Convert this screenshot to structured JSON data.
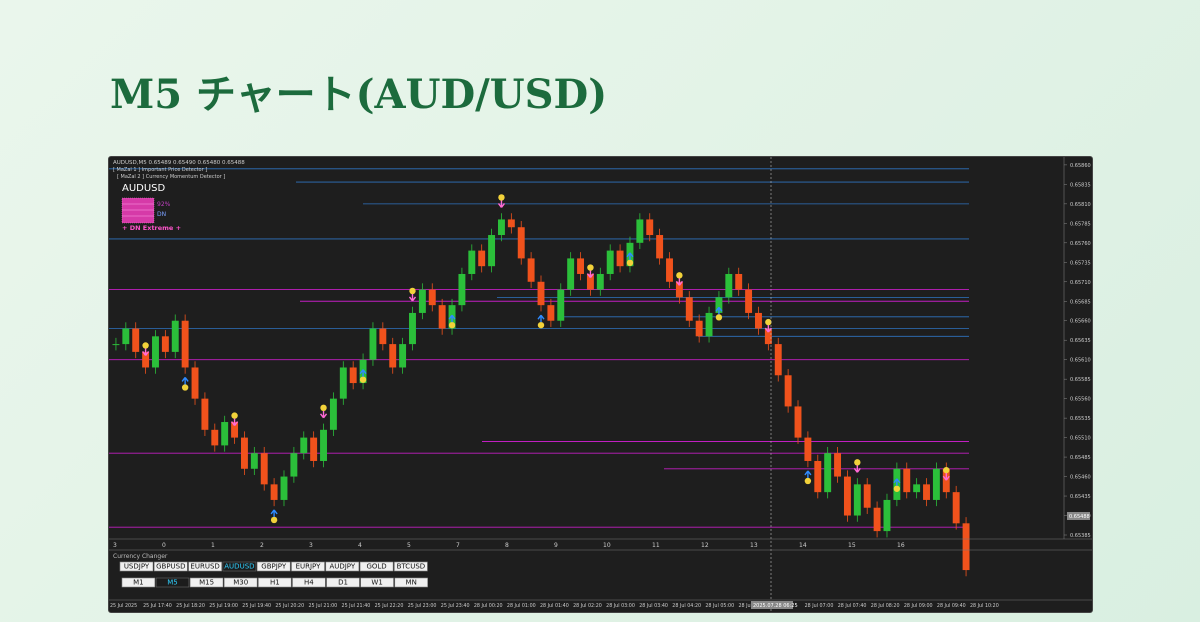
{
  "page_title": "M5 チャート(AUD/USD)",
  "header": {
    "symbol_info": "AUDUSD,M5  0.65489 0.65490 0.65480 0.65488",
    "indicator1": "[ MaZal 1 ] Important Price Detector ]",
    "indicator2": "[ MaZal 2 ] Currency Momentum Detector ]",
    "pair": "AUDUSD",
    "strength_pct": "92%",
    "strength_dn": "DN",
    "extreme_label": "+ DN Extreme +"
  },
  "colors": {
    "bull": "#2bbf3a",
    "bear": "#f0521c",
    "bg": "#1e1e1e",
    "blue_level": "#2f73c0",
    "magenta_level": "#c21fc2",
    "up_arrow": "#2f8bff",
    "down_arrow": "#ff6ad5",
    "marker": "#f2d23a"
  },
  "price_axis": [
    "0.65860",
    "0.65835",
    "0.65810",
    "0.65785",
    "0.65760",
    "0.65735",
    "0.65710",
    "0.65685",
    "0.65660",
    "0.65635",
    "0.65610",
    "0.65585",
    "0.65560",
    "0.65535",
    "0.65510",
    "0.65485",
    "0.65460",
    "0.65435",
    "0.65410",
    "0.65385"
  ],
  "current_price": "0.65488",
  "cursor_time": "2025.07.28 06:25",
  "sub_x_ticks": [
    "3",
    "0",
    "1",
    "2",
    "3",
    "4",
    "5",
    "7",
    "8",
    "9",
    "10",
    "11",
    "12",
    "13",
    "14",
    "15",
    "16"
  ],
  "time_axis": [
    "25 Jul 2025",
    "25 Jul 17:40",
    "25 Jul 18:20",
    "25 Jul 19:00",
    "25 Jul 19:40",
    "25 Jul 20:20",
    "25 Jul 21:00",
    "25 Jul 21:40",
    "25 Jul 22:20",
    "25 Jul 23:00",
    "25 Jul 23:40",
    "28 Jul 00:20",
    "28 Jul 01:00",
    "28 Jul 01:40",
    "28 Jul 02:20",
    "28 Jul 03:00",
    "28 Jul 03:40",
    "28 Jul 04:20",
    "28 Jul 05:00",
    "28 Jul 05:40",
    "28 Jul 06:20",
    "28 Jul 07:00",
    "28 Jul 07:40",
    "28 Jul 08:20",
    "28 Jul 09:00",
    "28 Jul 09:40",
    "28 Jul 10:20"
  ],
  "currency_changer": {
    "title": "Currency Changer",
    "pairs": [
      "USDJPY",
      "GBPUSD",
      "EURUSD",
      "AUDUSD",
      "GBPJPY",
      "EURJPY",
      "AUDJPY",
      "GOLD",
      "BTCUSD"
    ],
    "active_pair": "AUDUSD",
    "timeframes": [
      "M1",
      "M5",
      "M15",
      "M30",
      "H1",
      "H4",
      "D1",
      "W1",
      "MN"
    ],
    "active_tf": "M5"
  },
  "chart_data": {
    "type": "candlestick",
    "symbol": "AUDUSD",
    "timeframe": "M5",
    "ylim": [
      0.65385,
      0.65865
    ],
    "close_series": [
      0.6563,
      0.6565,
      0.6562,
      0.656,
      0.6564,
      0.6562,
      0.6566,
      0.656,
      0.6556,
      0.6552,
      0.655,
      0.6553,
      0.6551,
      0.6547,
      0.6549,
      0.6545,
      0.6543,
      0.6546,
      0.6549,
      0.6551,
      0.6548,
      0.6552,
      0.6556,
      0.656,
      0.6558,
      0.6561,
      0.6565,
      0.6563,
      0.656,
      0.6563,
      0.6567,
      0.657,
      0.6568,
      0.6565,
      0.6568,
      0.6572,
      0.6575,
      0.6573,
      0.6577,
      0.6579,
      0.6578,
      0.6574,
      0.6571,
      0.6568,
      0.6566,
      0.657,
      0.6574,
      0.6572,
      0.657,
      0.6572,
      0.6575,
      0.6573,
      0.6576,
      0.6579,
      0.6577,
      0.6574,
      0.6571,
      0.6569,
      0.6566,
      0.6564,
      0.6567,
      0.6569,
      0.6572,
      0.657,
      0.6567,
      0.6565,
      0.6563,
      0.6559,
      0.6555,
      0.6551,
      0.6548,
      0.6544,
      0.6549,
      0.6546,
      0.6541,
      0.6545,
      0.6542,
      0.6539,
      0.6543,
      0.6547,
      0.6544,
      0.6545,
      0.6543,
      0.6547,
      0.6544,
      0.654,
      0.6534
    ],
    "blue_levels": [
      0.65855,
      0.65838,
      0.6581,
      0.65765,
      0.6569,
      0.65665,
      0.6565,
      0.6564
    ],
    "magenta_levels": [
      0.657,
      0.65685,
      0.6561,
      0.65505,
      0.6549,
      0.6547,
      0.65395
    ],
    "current_price": 0.65488
  }
}
